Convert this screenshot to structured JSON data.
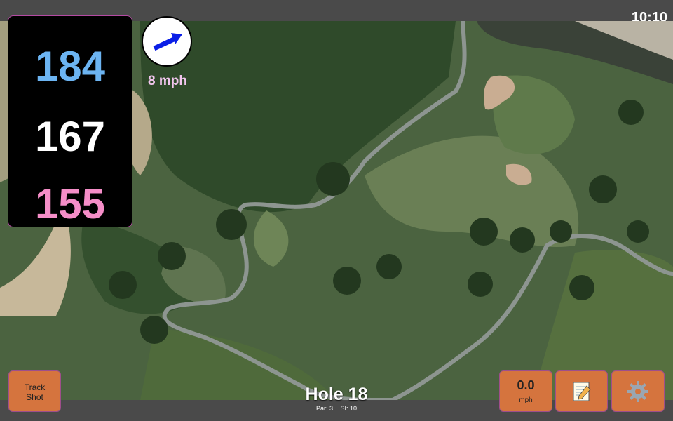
{
  "status": {
    "time": "10:10"
  },
  "distances": {
    "back": "184",
    "middle": "167",
    "front": "155"
  },
  "wind": {
    "speed_label": "8 mph",
    "icon": "wind-arrow-icon"
  },
  "buttons": {
    "track_shot_line1": "Track",
    "track_shot_line2": "Shot",
    "speed_value": "0.0",
    "speed_unit": "mph",
    "notes_icon": "notepad-icon",
    "settings_icon": "gear-icon"
  },
  "hole": {
    "title": "Hole 18",
    "par": "Par: 3",
    "si": "SI: 10"
  },
  "colors": {
    "back_distance": "#6cb4f2",
    "middle_distance": "#ffffff",
    "front_distance": "#f58ec8",
    "button_bg": "#d5743e",
    "wind_label": "#f2c6ee"
  }
}
